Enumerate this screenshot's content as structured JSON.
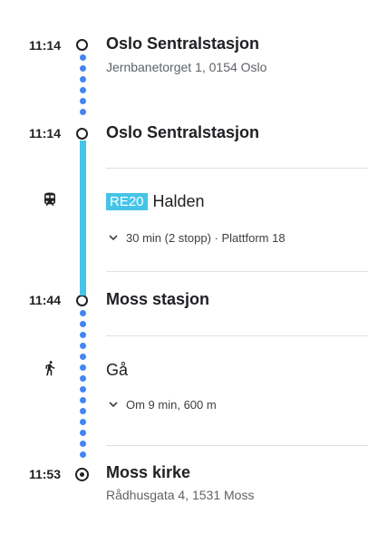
{
  "stops": {
    "origin": {
      "time": "11:14",
      "name": "Oslo Sentralstasjon",
      "address": "Jernbanetorget 1, 0154 Oslo"
    },
    "board": {
      "time": "11:14",
      "name": "Oslo Sentralstasjon"
    },
    "alight": {
      "time": "11:44",
      "name": "Moss stasjon"
    },
    "destination": {
      "time": "11:53",
      "name": "Moss kirke",
      "address": "Rådhusgata 4, 1531 Moss"
    }
  },
  "train_leg": {
    "icon": "train-icon",
    "route": "RE20",
    "headsign": "Halden",
    "details": "30 min (2 stopp) · Plattform 18",
    "color": "#46c4e8"
  },
  "walk_leg": {
    "icon": "walk-icon",
    "label": "Gå",
    "details": "Om 9 min, 600 m",
    "color": "#4285f4"
  }
}
